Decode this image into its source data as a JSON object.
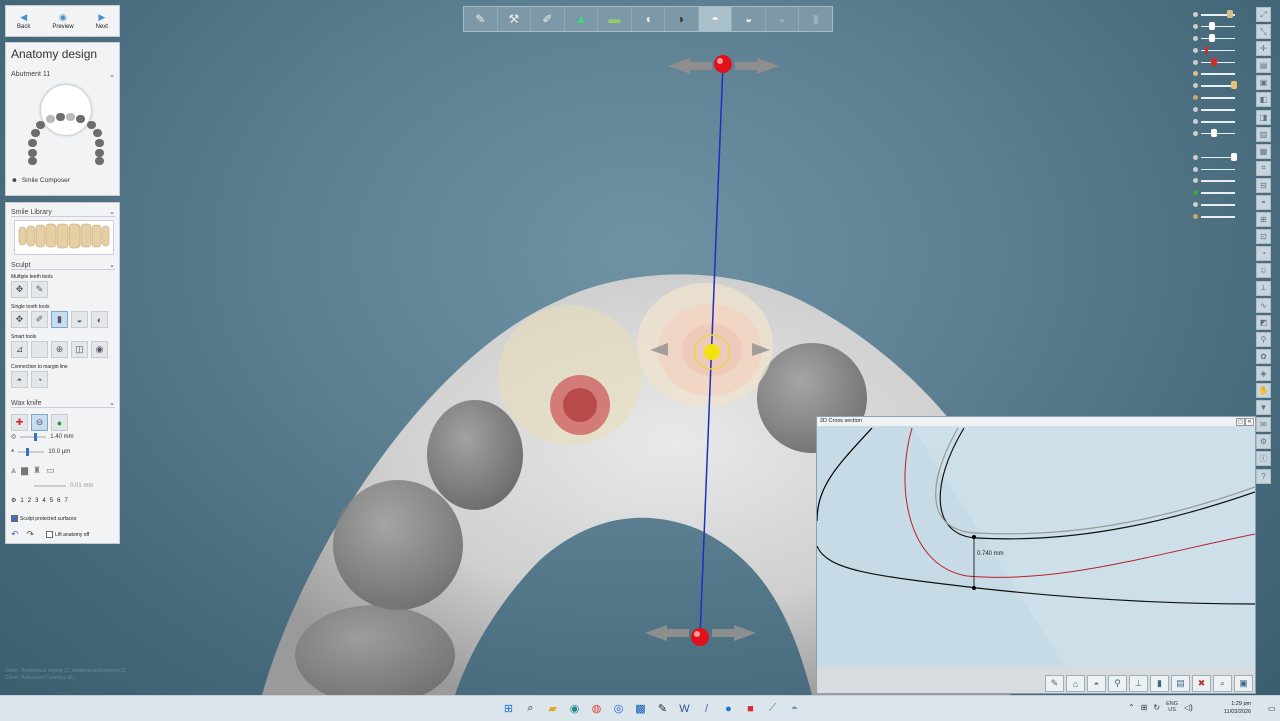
{
  "nav": {
    "back": "Back",
    "preview": "Preview",
    "next": "Next"
  },
  "anatomy": {
    "title": "Anatomy design",
    "tooth_select": "Abutment 11",
    "smile_composer": "Smile Composer"
  },
  "smile_library": {
    "title": "Smile Library"
  },
  "sculpt": {
    "title": "Sculpt",
    "multiple": "Multiple teeth tools",
    "single": "Single tooth tools",
    "smart": "Smart tools",
    "margin": "Connection to margin line"
  },
  "wax_knife": {
    "title": "Wax knife",
    "size_value": "1.40 mm",
    "step_value": "10.0 µm",
    "min_value": "0.01 mm",
    "numbers": [
      "1",
      "2",
      "3",
      "4",
      "5",
      "6",
      "7"
    ],
    "sculpt_protected": "Sculpt protected surfaces",
    "lift_anatomy": "Lift anatomy off"
  },
  "cross_section": {
    "title": "2D Cross section",
    "measurement": "0.740 mm"
  },
  "status_lines": [
    "Order : Anatomical coping 21, Anatomical Abutment 11",
    "Client : Advanced Ceramics EU"
  ],
  "taskbar": {
    "lang": "ENG",
    "region": "US",
    "time": "1:29 pm",
    "date": "11/03/2026"
  },
  "colors": {
    "handle_red": "#e0111a",
    "handle_yellow": "#f2e20d",
    "axis_blue": "#1f2fbf",
    "margin_red": "#b8202a"
  },
  "icons": {
    "top_toolbar": [
      "scan-icon",
      "tools-icon",
      "brush-icon",
      "model-icon",
      "gingiva-icon",
      "crown-icon",
      "dark-crown-icon",
      "tooth-active-icon",
      "tooth-icon",
      "tooth-disabled-icon",
      "tooth-disabled-2-icon"
    ]
  }
}
